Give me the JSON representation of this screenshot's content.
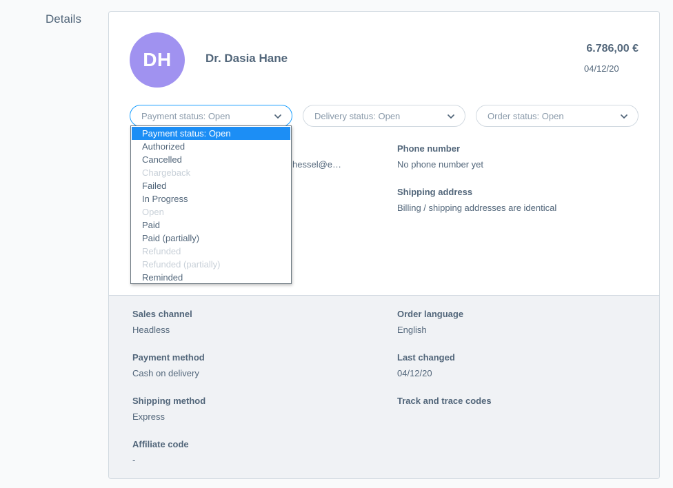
{
  "section_label": "Details",
  "customer": {
    "initials": "DH",
    "name": "Dr. Dasia Hane",
    "total": "6.786,00 €",
    "date": "04/12/20",
    "email_fragment": "hessel@e…"
  },
  "statuses": {
    "payment": "Payment status: Open",
    "delivery": "Delivery status: Open",
    "order": "Order status: Open"
  },
  "payment_options": [
    {
      "label": "Payment status: Open",
      "state": "selected"
    },
    {
      "label": "Authorized",
      "state": "enabled"
    },
    {
      "label": "Cancelled",
      "state": "enabled"
    },
    {
      "label": "Chargeback",
      "state": "disabled"
    },
    {
      "label": "Failed",
      "state": "enabled"
    },
    {
      "label": "In Progress",
      "state": "enabled"
    },
    {
      "label": "Open",
      "state": "disabled"
    },
    {
      "label": "Paid",
      "state": "enabled"
    },
    {
      "label": "Paid (partially)",
      "state": "enabled"
    },
    {
      "label": "Refunded",
      "state": "disabled"
    },
    {
      "label": "Refunded (partially)",
      "state": "disabled"
    },
    {
      "label": "Reminded",
      "state": "enabled"
    }
  ],
  "contact": {
    "phone_label": "Phone number",
    "phone_value": "No phone number yet",
    "shipping_address_label": "Shipping address",
    "shipping_address_value": "Billing / shipping addresses are identical"
  },
  "meta": {
    "sales_channel_label": "Sales channel",
    "sales_channel_value": "Headless",
    "payment_method_label": "Payment method",
    "payment_method_value": "Cash on delivery",
    "shipping_method_label": "Shipping method",
    "shipping_method_value": "Express",
    "affiliate_label": "Affiliate code",
    "affiliate_value": "-",
    "order_language_label": "Order language",
    "order_language_value": "English",
    "last_changed_label": "Last changed",
    "last_changed_value": "04/12/20",
    "track_label": "Track and trace codes"
  },
  "colors": {
    "avatar": "#a092f0",
    "selection": "#1c8ef5",
    "focus_border": "#189eff",
    "text": "#52667a"
  }
}
